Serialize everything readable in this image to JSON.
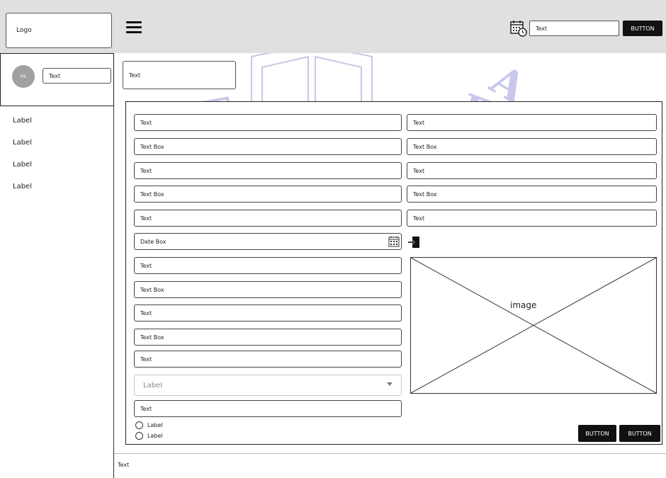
{
  "header": {
    "logo_text": "Logo",
    "search_input_value": "Text",
    "button_label": "BUTTON"
  },
  "user": {
    "initials": "MK",
    "input_value": "Text"
  },
  "sidebar": {
    "items": [
      {
        "label": "Label"
      },
      {
        "label": "Label"
      },
      {
        "label": "Label"
      },
      {
        "label": "Label"
      }
    ]
  },
  "content": {
    "header_box_text": "Text"
  },
  "form": {
    "left_fields": [
      {
        "value": "Text"
      },
      {
        "value": "Text Box"
      },
      {
        "value": "Text"
      },
      {
        "value": "Text Box"
      },
      {
        "value": "Text"
      },
      {
        "value": "Date Box"
      },
      {
        "value": "Text"
      },
      {
        "value": "Text Box"
      },
      {
        "value": "Text"
      },
      {
        "value": "Text Box"
      },
      {
        "value": "Text"
      }
    ],
    "right_fields": [
      {
        "value": "Text"
      },
      {
        "value": "Text Box"
      },
      {
        "value": "Text"
      },
      {
        "value": "Text Box"
      },
      {
        "value": "Text"
      }
    ],
    "dropdown": {
      "selected": "Label"
    },
    "bottom_field": {
      "value": "Text"
    },
    "radios": [
      {
        "label": "Label"
      },
      {
        "label": "Label"
      }
    ],
    "image_label": "image",
    "buttons": [
      {
        "label": "BUTTON"
      },
      {
        "label": "BUTTON"
      }
    ]
  },
  "footer": {
    "text": "Text"
  },
  "icons": {
    "menu": "hamburger-menu-icon",
    "calendar": "calendar-clock-icon",
    "date_picker": "calendar-icon",
    "login": "login-icon",
    "dropdown": "caret-down-icon"
  },
  "colors": {
    "topbar_bg": "#e0e0e0",
    "button_bg": "#111111",
    "avatar_bg": "#a0a0a0",
    "watermark": "#c7c8ea"
  }
}
